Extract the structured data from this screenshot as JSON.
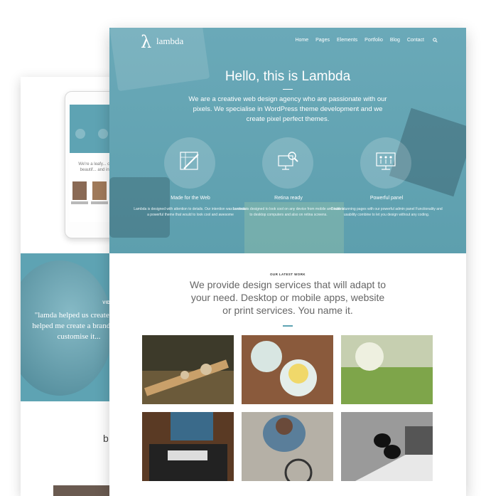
{
  "back_page": {
    "tablet_text": "We're a leafy... create beautif... and inno...",
    "video_title": "VIDEO TES",
    "quote": "\"lamda helped us create th... helped me create a brand ne... customise it...",
    "bottom_text": "b"
  },
  "nav": {
    "logo_glyph": "λ",
    "logo_text": "lambda",
    "items": [
      "Home",
      "Pages",
      "Elements",
      "Portfolio",
      "Blog",
      "Contact"
    ]
  },
  "hero": {
    "title": "Hello, this is Lambda",
    "description": "We are a creative web design agency who are passionate with our pixels. We specialise in WordPress theme development and we create pixel perfect themes."
  },
  "features": [
    {
      "icon": "design-icon",
      "title": "Made for the Web",
      "description": "Lambda is designed with attention to details. Our intention was to create a powerful theme that would to look cool and awesome"
    },
    {
      "icon": "retina-icon",
      "title": "Retina ready",
      "description": "Lambda is designed to look cool on any device from mobile and tablets to desktop computers and also on retina screens."
    },
    {
      "icon": "panel-icon",
      "title": "Powerful panel",
      "description": "Create stunning pages with our powerful admin panel Functionality and usability combine to let you design without any coding."
    }
  ],
  "work": {
    "label": "OUR LATEST WORK",
    "title": "We provide design services that will adapt to your need. Desktop or mobile apps, website or print services. You name it."
  },
  "portfolio": [
    {
      "name": "guitar",
      "color": "#6b5a3a"
    },
    {
      "name": "drinks",
      "color": "#8a5a3c"
    },
    {
      "name": "grass",
      "color": "#7ea54a"
    },
    {
      "name": "workspace",
      "color": "#3a6a8a"
    },
    {
      "name": "cyclist",
      "color": "#5a7e9a"
    },
    {
      "name": "laptop-glasses",
      "color": "#cfcfcf"
    }
  ],
  "colors": {
    "accent": "#5ea3b3"
  }
}
